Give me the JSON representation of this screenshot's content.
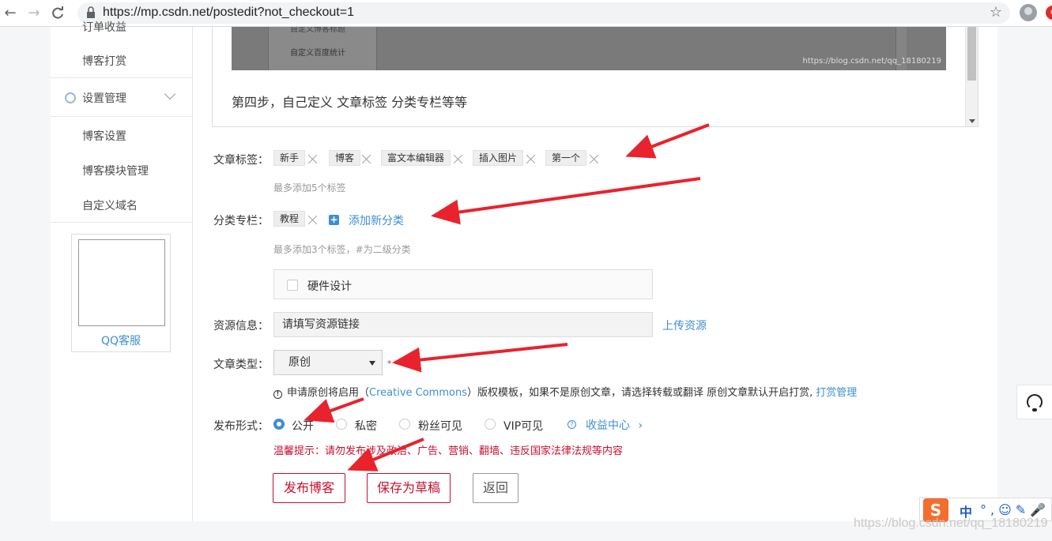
{
  "browser": {
    "back_glyph": "←",
    "forward_glyph": "→",
    "reload_glyph": "C",
    "url": "https://mp.csdn.net/postedit?not_checkout=1",
    "star_glyph": "☆",
    "badge": "e"
  },
  "sidebar": {
    "partial_item": "订单收益",
    "reward": "博客打赏",
    "settings_section": "设置管理",
    "items": [
      "博客设置",
      "博客模块管理",
      "自定义域名"
    ],
    "qq_service": "QQ客服"
  },
  "editor": {
    "screenshot_text_1": "自定义博客标题",
    "screenshot_text_2": "自定义百度统计",
    "screenshot_watermark": "https://blog.csdn.net/qq_18180219",
    "step_text": "第四步，自己定义 文章标签  分类专栏等等"
  },
  "form": {
    "tags_label": "文章标签：",
    "tags": [
      "新手",
      "博客",
      "富文本编辑器",
      "插入图片",
      "第一个"
    ],
    "tags_hint": "最多添加5个标签",
    "category_label": "分类专栏：",
    "categories": [
      "教程"
    ],
    "add_category": "添加新分类",
    "category_hint": "最多添加3个标签，#为二级分类",
    "category_option": "硬件设计",
    "resource_label": "资源信息：",
    "resource_value": "请填写资源链接",
    "upload_link": "上传资源",
    "type_label": "文章类型：",
    "type_selected": "原创",
    "required_mark": "*",
    "cc_prefix": "申请原创将启用（",
    "cc_link": "Creative Commons",
    "cc_middle": "）版权模板，如果不是原创文章，请选择转载或翻译 原创文章默认开启打赏,",
    "cc_reward_link": "打赏管理",
    "publish_label": "发布形式：",
    "visibility_options": [
      "公开",
      "私密",
      "粉丝可见",
      "VIP可见"
    ],
    "visibility_selected": "公开",
    "income_link": "收益中心",
    "income_chevron": "›",
    "warning": "温馨提示：请勿发布涉及政治、广告、营销、翻墙、违反国家法律法规等内容",
    "publish_btn": "发布博客",
    "draft_btn": "保存为草稿",
    "back_btn": "返回"
  },
  "ime": {
    "logo": "S",
    "mode": "中",
    "icons": "°,☺✎🎤"
  },
  "watermark": "https://blog.csdn.net/qq_18180219",
  "colors": {
    "accent_blue": "#3e8ed0",
    "brand_red": "#c8102e",
    "arrow_red": "#e8232e"
  }
}
